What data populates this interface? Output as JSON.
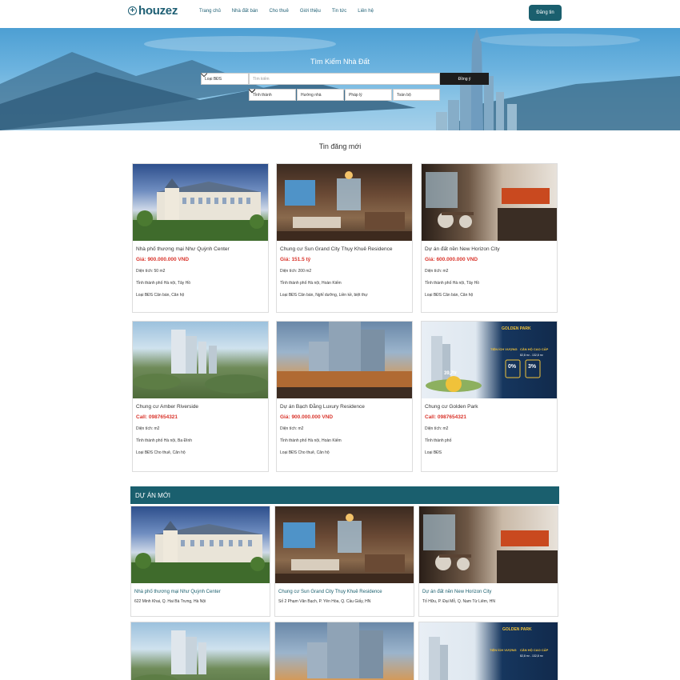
{
  "header": {
    "logo_text": "houzez",
    "nav": [
      "Trang chủ",
      "Nhà đất bán",
      "Cho thuê",
      "Giới thiệu",
      "Tin tức",
      "Liên hệ"
    ],
    "post_button": "Đăng tin"
  },
  "search": {
    "title": "Tìm Kiếm Nhà Đất",
    "type_select": "Loại BĐS",
    "input_placeholder": "Tìm kiếm",
    "submit": "Đồng ý",
    "filters": [
      "Tỉnh thành",
      "Hướng nhà",
      "Pháp lý",
      "Toàn bộ"
    ]
  },
  "listings": {
    "title": "Tin đăng mới",
    "area_label": "Diện tích:",
    "items": [
      {
        "title": "Nhà phố thương mại Như Quỳnh Center",
        "price": "Giá: 900.000.000 VND",
        "area": "Diện tích: 50   m2",
        "location": "Tỉnh thành phố Hà nội, Tây Hồ",
        "type": "Loại BĐS Căn bán, Căn hộ"
      },
      {
        "title": "Chung cư Sun Grand City Thụy Khuê Residence",
        "price": "Giá: 151.5 tỷ",
        "area": "Diện tích: 200  m2",
        "location": "Tỉnh thành phố Hà nội, Hoàn Kiếm",
        "type": "Loại BĐS Căn bán, Nghỉ dưỡng, Liền kề, biệt thự"
      },
      {
        "title": "Dự án đất nền New Horizon City",
        "price": "Giá: 600.000.000 VND",
        "area": "Diện tích:    m2",
        "location": "Tỉnh thành phố Hà nội, Tây Hồ",
        "type": "Loại BĐS Căn bán, Căn hộ"
      },
      {
        "title": "Chung cư Amber Riverside",
        "price": "Call: 0987654321",
        "area": "Diện tích:    m2",
        "location": "Tỉnh thành phố Hà nội, Ba Đình",
        "type": "Loại BĐS Cho thuê, Căn hộ"
      },
      {
        "title": "Dự án Bạch Đằng Luxury Residence",
        "price": "Giá: 900.000.000 VND",
        "area": "Diện tích:    m2",
        "location": "Tỉnh thành phố Hà nội, Hoàn Kiếm",
        "type": "Loại BĐS Cho thuê, Căn hộ"
      },
      {
        "title": "Chung cư Golden Park",
        "price": "Call: 0987654321",
        "area": "Diện tích:    m2",
        "location": "Tỉnh thành phố",
        "type": "Loại BĐS"
      }
    ]
  },
  "projects": {
    "title": "DỰ ÁN MỚI",
    "items": [
      {
        "title": "Nhà phố thương mại Như Quỳnh Center",
        "address": "622 Minh Khai, Q. Hai Bà Trưng, Hà Nội"
      },
      {
        "title": "Chung cư Sun Grand City Thụy Khuê Residence",
        "address": "Số 2 Phạm Văn Bạch, P. Yên Hòa, Q. Cầu Giấy, HN"
      },
      {
        "title": "Dự án đất nền New Horizon City",
        "address": "Tố Hữu, P. Đại Mỗ, Q. Nam Từ Liêm, HN"
      }
    ]
  },
  "golden_park": {
    "brand": "GOLDEN PARK",
    "tag1": "TIỆN ÍCH VƯỢNG",
    "tag2": "CĂN HỘ CAO CẤP",
    "area": "82,8 m² - 132,8 m²",
    "price": "39,7tr",
    "badge1": "0%",
    "badge2": "3%"
  }
}
